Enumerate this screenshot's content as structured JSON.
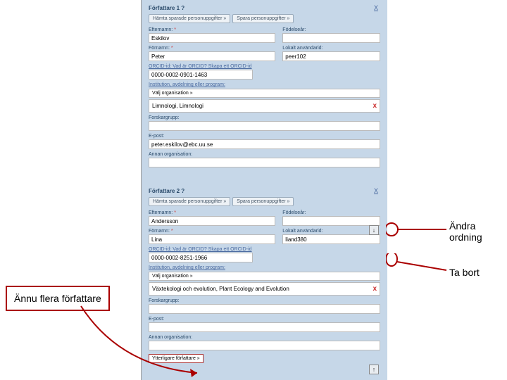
{
  "author1": {
    "title": "Författare 1 ?",
    "btn_load": "Hämta sparade personuppgifter »",
    "btn_save": "Spara personuppgifter »",
    "lastname_lbl": "Efternamn:",
    "lastname_val": "Eskilov",
    "birth_lbl": "Födelseår:",
    "firstname_lbl": "Förnamn:",
    "firstname_val": "Peter",
    "userid_lbl": "Lokalt användarid:",
    "userid_val": "peer102",
    "orcid_lbl": "ORCID-id: Vad är ORCID? Skapa ett ORCID-id",
    "orcid_val": "0000-0002-0901-1463",
    "inst_lbl": "Institution, avdelning eller program:",
    "inst_select": "Välj organisation »",
    "org_selected": "Limnologi, Limnologi",
    "group_lbl": "Forskargrupp:",
    "email_lbl": "E-post:",
    "email_val": "peter.eskilov@ebc.uu.se",
    "otherorg_lbl": "Annan organisation:",
    "remove": "X"
  },
  "author2": {
    "title": "Författare 2 ?",
    "lastname_val": "Andersson",
    "firstname_val": "Lina",
    "userid_val": "liand380",
    "orcid_val": "0000-0002-8251-1966",
    "org_selected": "Växtekologi och evolution, Plant Ecology and Evolution",
    "addmore": "Ytterligare författare »"
  },
  "labels": {
    "reorder": "Ändra ordning",
    "remove": "Ta bort",
    "moreauthors": "Ännu flera författare"
  }
}
